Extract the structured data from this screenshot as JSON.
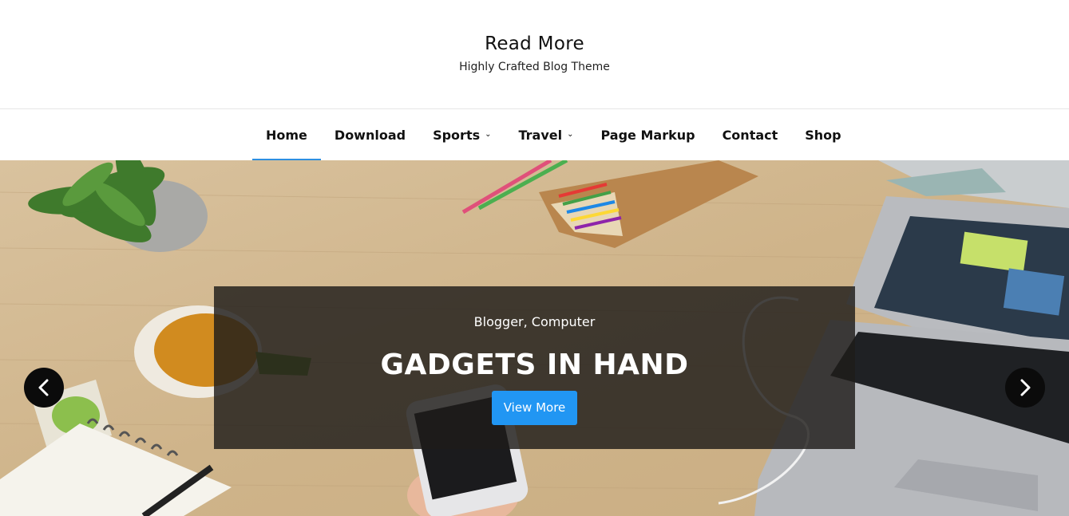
{
  "site": {
    "title": "Read More",
    "tagline": "Highly Crafted Blog Theme"
  },
  "nav": {
    "items": [
      {
        "label": "Home",
        "active": true,
        "has_submenu": false
      },
      {
        "label": "Download",
        "active": false,
        "has_submenu": false
      },
      {
        "label": "Sports",
        "active": false,
        "has_submenu": true
      },
      {
        "label": "Travel",
        "active": false,
        "has_submenu": true
      },
      {
        "label": "Page Markup",
        "active": false,
        "has_submenu": false
      },
      {
        "label": "Contact",
        "active": false,
        "has_submenu": false
      },
      {
        "label": "Shop",
        "active": false,
        "has_submenu": false
      }
    ],
    "submenu_icon": "chevron-down-icon",
    "active_color": "#2e8fe0"
  },
  "slider": {
    "categories": "Blogger, Computer",
    "title": "GADGETS IN HAND",
    "button_label": "View More",
    "button_color": "#2196f3",
    "prev_icon": "chevron-left-icon",
    "next_icon": "chevron-right-icon"
  }
}
